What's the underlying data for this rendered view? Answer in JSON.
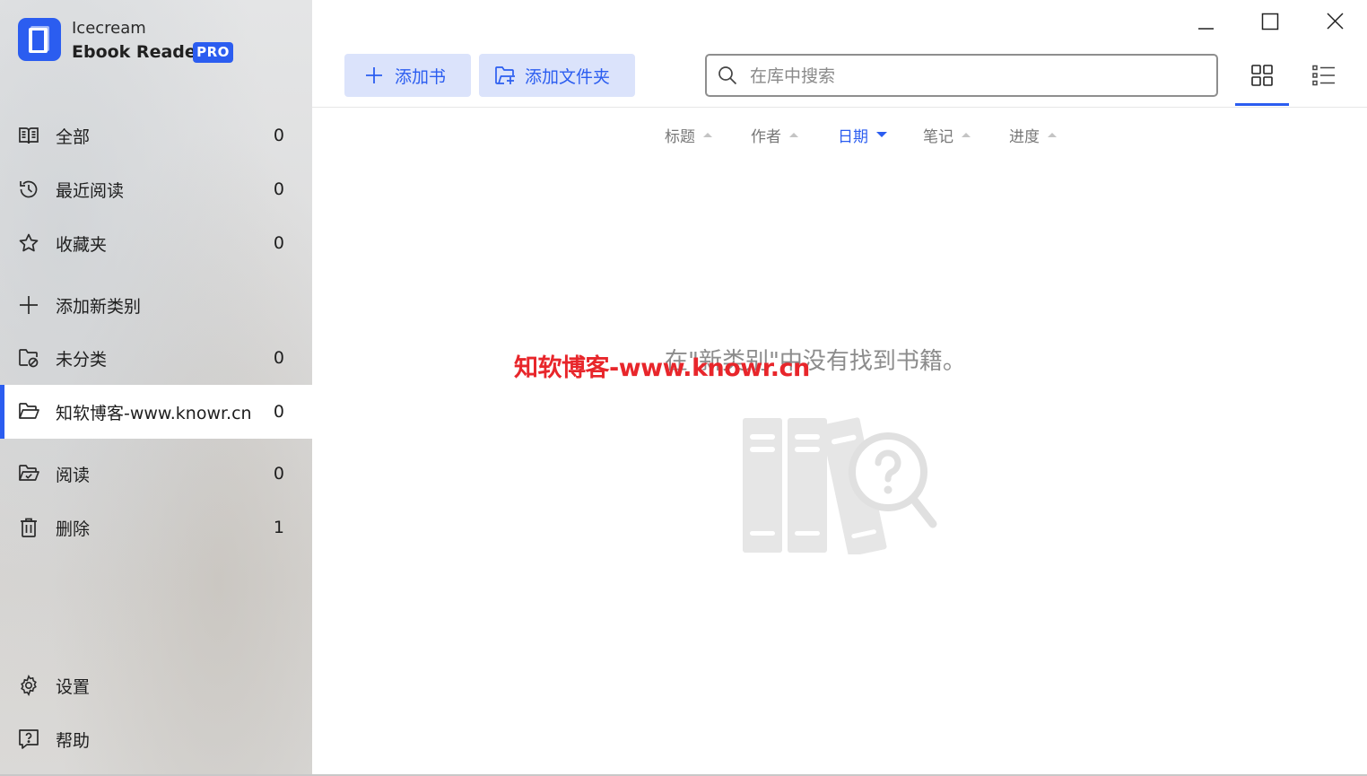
{
  "app": {
    "name_line1": "Icecream",
    "name_line2": "Ebook Reader",
    "badge": "PRO",
    "accent_color": "#2b5df0"
  },
  "sidebar": {
    "items": [
      {
        "label": "全部",
        "count": "0",
        "icon": "book-open-icon"
      },
      {
        "label": "最近阅读",
        "count": "0",
        "icon": "history-icon"
      },
      {
        "label": "收藏夹",
        "count": "0",
        "icon": "star-icon"
      },
      {
        "label": "添加新类别",
        "icon": "plus-icon"
      },
      {
        "label": "未分类",
        "count": "0",
        "icon": "folder-unsorted-icon"
      },
      {
        "label": "知软博客-www.knowr.cn",
        "count": "0",
        "icon": "folder-open-icon",
        "active": true
      },
      {
        "label": "阅读",
        "count": "0",
        "icon": "folder-check-icon"
      },
      {
        "label": "删除",
        "count": "1",
        "icon": "trash-icon"
      }
    ],
    "footer": [
      {
        "label": "设置",
        "icon": "gear-icon"
      },
      {
        "label": "帮助",
        "icon": "help-icon"
      }
    ]
  },
  "toolbar": {
    "add_book": "添加书",
    "add_folder": "添加文件夹",
    "search_placeholder": "在库中搜索",
    "view_mode": "grid"
  },
  "sort": {
    "items": [
      "标题",
      "作者",
      "日期",
      "笔记",
      "进度"
    ],
    "active": "日期"
  },
  "empty_state": {
    "message": "在\"新类别\"中没有找到书籍。"
  },
  "watermark": "知软博客-www.knowr.cn"
}
